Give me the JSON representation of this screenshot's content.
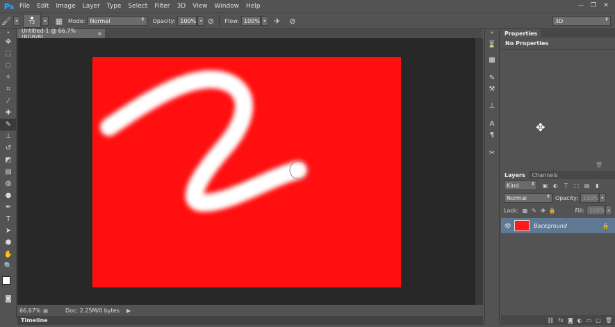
{
  "app": {
    "logo": "Ps"
  },
  "menu": [
    "File",
    "Edit",
    "Image",
    "Layer",
    "Type",
    "Select",
    "Filter",
    "3D",
    "View",
    "Window",
    "Help"
  ],
  "window_controls": {
    "minimize": "—",
    "restore": "❐",
    "close": "✕"
  },
  "options": {
    "brush_size": "72",
    "mode_label": "Mode:",
    "mode_value": "Normal",
    "opacity_label": "Opacity:",
    "opacity_value": "100%",
    "flow_label": "Flow:",
    "flow_value": "100%",
    "workspace": "3D"
  },
  "document": {
    "tab_title": "Untitled-1 @ 66.7% (RGB/8)",
    "tab_close": "×",
    "canvas_color": "#ff0f0f",
    "stroke_color": "#ffffff"
  },
  "status": {
    "zoom": "66.67%",
    "doc_info": "Doc: 2.25M/0 bytes"
  },
  "timeline": {
    "label": "Timeline"
  },
  "properties": {
    "tab": "Properties",
    "content": "No Properties"
  },
  "layers": {
    "tabs": [
      "Layers",
      "Channels"
    ],
    "filter_kind": "Kind",
    "blend_mode": "Normal",
    "opacity_label": "Opacity:",
    "opacity_value": "100%",
    "lock_label": "Lock:",
    "fill_label": "Fill:",
    "fill_value": "100%",
    "layer_name": "Background",
    "layer_color": "#ff1a1a"
  }
}
